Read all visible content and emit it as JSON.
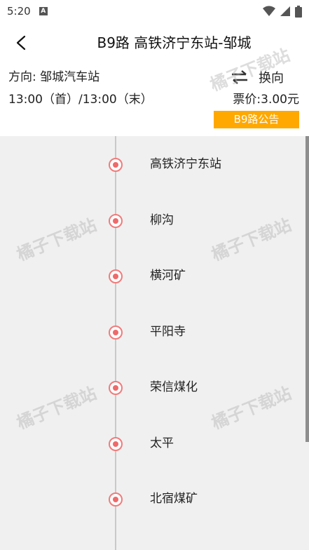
{
  "status_bar": {
    "time": "5:20",
    "notification_glyph": "A"
  },
  "header": {
    "title": "B9路 高铁济宁东站-邹城"
  },
  "info": {
    "direction_label": "方向:",
    "direction_value": "邹城汽车站",
    "swap_label": "换向",
    "times": "13:00（首）/13:00（末）",
    "fare": "票价:3.00元",
    "notice_button": "B9路公告"
  },
  "stations": [
    {
      "name": "高铁济宁东站"
    },
    {
      "name": "柳沟"
    },
    {
      "name": "横河矿"
    },
    {
      "name": "平阳寺"
    },
    {
      "name": "荣信煤化"
    },
    {
      "name": "太平"
    },
    {
      "name": "北宿煤矿"
    }
  ],
  "watermark": "橘子下载站",
  "colors": {
    "accent": "#ffa800",
    "station_dot": "#ee6a6a",
    "list_background": "#f0f0f0"
  }
}
